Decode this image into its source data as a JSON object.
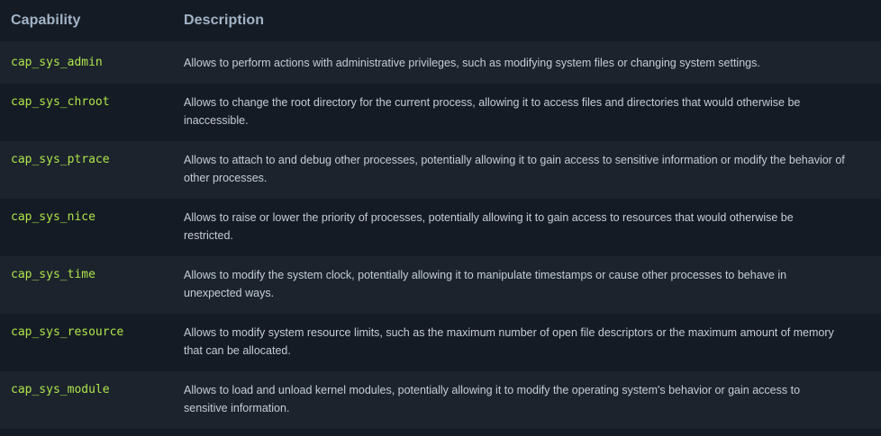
{
  "table": {
    "headers": {
      "capability": "Capability",
      "description": "Description"
    },
    "rows": [
      {
        "capability": "cap_sys_admin",
        "description": "Allows to perform actions with administrative privileges, such as modifying system files or changing system settings."
      },
      {
        "capability": "cap_sys_chroot",
        "description": "Allows to change the root directory for the current process, allowing it to access files and directories that would otherwise be inaccessible."
      },
      {
        "capability": "cap_sys_ptrace",
        "description": "Allows to attach to and debug other processes, potentially allowing it to gain access to sensitive information or modify the behavior of other processes."
      },
      {
        "capability": "cap_sys_nice",
        "description": "Allows to raise or lower the priority of processes, potentially allowing it to gain access to resources that would otherwise be restricted."
      },
      {
        "capability": "cap_sys_time",
        "description": "Allows to modify the system clock, potentially allowing it to manipulate timestamps or cause other processes to behave in unexpected ways."
      },
      {
        "capability": "cap_sys_resource",
        "description": "Allows to modify system resource limits, such as the maximum number of open file descriptors or the maximum amount of memory that can be allocated."
      },
      {
        "capability": "cap_sys_module",
        "description": "Allows to load and unload kernel modules, potentially allowing it to modify the operating system's behavior or gain access to sensitive information."
      }
    ]
  },
  "colors": {
    "background": "#151b24",
    "row_alt": "#1c232d",
    "header_text": "#a3b4c8",
    "capability_text": "#aee44a",
    "description_text": "#c4cdd8"
  }
}
